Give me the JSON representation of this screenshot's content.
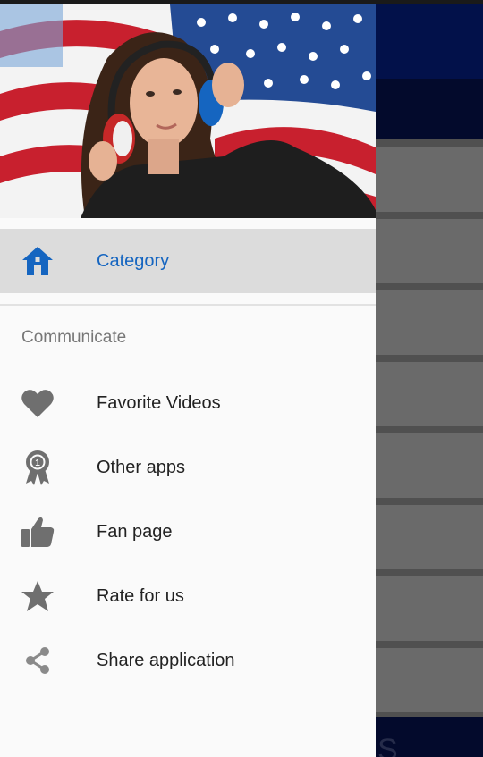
{
  "drawer": {
    "header_image": "woman with headphones in front of american flag",
    "selected_item": {
      "label": "Category",
      "icon": "home-icon"
    },
    "section_title": "Communicate",
    "items": [
      {
        "label": "Favorite Videos",
        "icon": "heart-icon"
      },
      {
        "label": "Other apps",
        "icon": "award-ribbon-icon"
      },
      {
        "label": "Fan page",
        "icon": "thumbs-up-icon"
      },
      {
        "label": "Rate for us",
        "icon": "star-icon"
      },
      {
        "label": "Share application",
        "icon": "share-icon"
      }
    ]
  },
  "colors": {
    "accent": "#1565c0",
    "icon_gray": "#6f6f6f",
    "selected_bg": "#dcdcdc",
    "toolbar_bg": "#02114a"
  }
}
